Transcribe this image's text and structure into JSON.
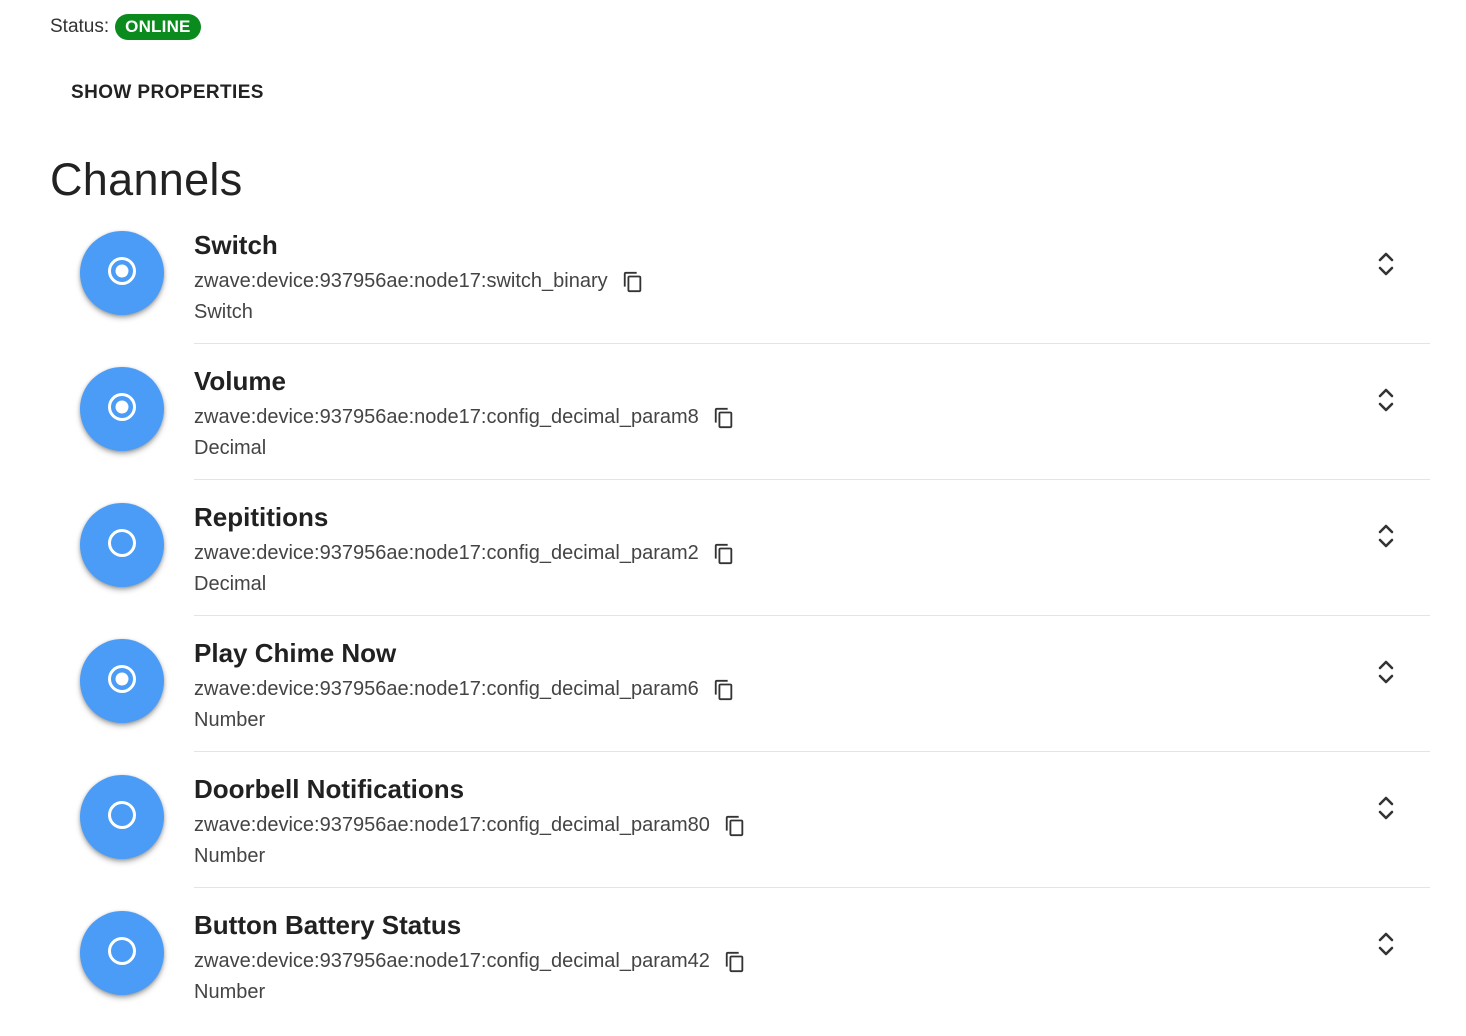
{
  "status": {
    "label": "Status:",
    "value": "ONLINE",
    "color": "#0b8a1e"
  },
  "actions": {
    "show_properties_label": "SHOW PROPERTIES"
  },
  "section": {
    "title": "Channels"
  },
  "accent_color": "#4a9cf6",
  "channels": [
    {
      "name": "Switch",
      "uid": "zwave:device:937956ae:node17:switch_binary",
      "type": "Switch",
      "linked": true,
      "status_icon": "radio-checked-icon"
    },
    {
      "name": "Volume",
      "uid": "zwave:device:937956ae:node17:config_decimal_param8",
      "type": "Decimal",
      "linked": true,
      "status_icon": "radio-checked-icon"
    },
    {
      "name": "Repititions",
      "uid": "zwave:device:937956ae:node17:config_decimal_param2",
      "type": "Decimal",
      "linked": false,
      "status_icon": "radio-unchecked-icon"
    },
    {
      "name": "Play Chime Now",
      "uid": "zwave:device:937956ae:node17:config_decimal_param6",
      "type": "Number",
      "linked": true,
      "status_icon": "radio-checked-icon"
    },
    {
      "name": "Doorbell Notifications",
      "uid": "zwave:device:937956ae:node17:config_decimal_param80",
      "type": "Number",
      "linked": false,
      "status_icon": "radio-unchecked-icon"
    },
    {
      "name": "Button Battery Status",
      "uid": "zwave:device:937956ae:node17:config_decimal_param42",
      "type": "Number",
      "linked": false,
      "status_icon": "radio-unchecked-icon"
    }
  ],
  "icons": {
    "copy": "copy-icon",
    "expand": "unfold-more-icon"
  }
}
